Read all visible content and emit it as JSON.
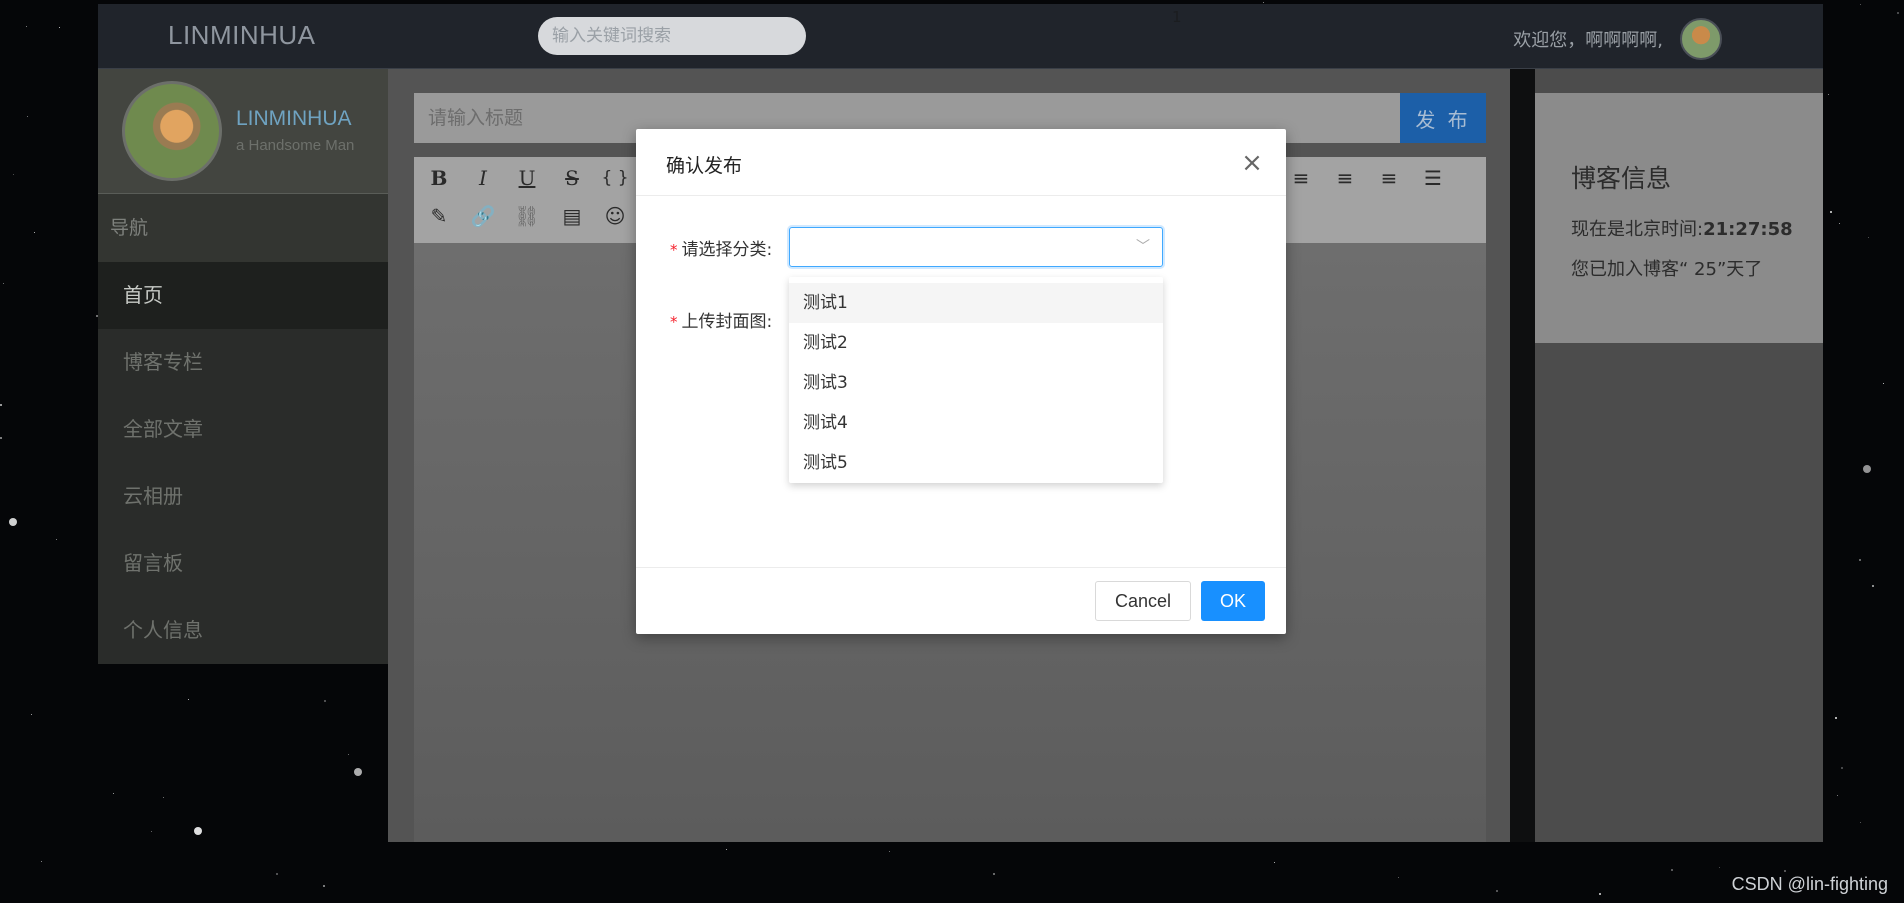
{
  "header": {
    "brand": "LINMINHUA",
    "search_placeholder": "输入关键词搜索",
    "marker": "1",
    "welcome": "欢迎您，啊啊啊啊,"
  },
  "sidebar": {
    "name": "LINMINHUA",
    "tagline": "a Handsome Man",
    "nav_heading": "导航",
    "items": [
      {
        "label": "首页",
        "active": true
      },
      {
        "label": "博客专栏"
      },
      {
        "label": "全部文章"
      },
      {
        "label": "云相册"
      },
      {
        "label": "留言板"
      },
      {
        "label": "个人信息"
      }
    ]
  },
  "editor": {
    "title_placeholder": "请输入标题",
    "publish_label": "发 布",
    "toolbar_row1": [
      "B",
      "I",
      "U",
      "S",
      "{ }"
    ],
    "toolbar_icons_row1": [
      "bold-icon",
      "italic-icon",
      "underline-icon",
      "strikethrough-icon",
      "code-icon"
    ],
    "toolbar_icons_row2": [
      "pen-icon",
      "link-icon",
      "unlink-icon",
      "code-block-icon",
      "emoji-icon"
    ],
    "toolbar_icons_right": [
      "align-left-icon",
      "align-center-icon",
      "align-right-icon",
      "align-justify-icon"
    ]
  },
  "blog_info": {
    "title": "博客信息",
    "time_label": "现在是北京时间:",
    "time_value": "21:27:58",
    "joined": "您已加入博客“ 25”天了"
  },
  "modal": {
    "title": "确认发布",
    "category_label": "请选择分类:",
    "cover_label": "上传封面图:",
    "options": [
      "测试1",
      "测试2",
      "测试3",
      "测试4",
      "测试5"
    ],
    "cancel_label": "Cancel",
    "ok_label": "OK"
  },
  "watermark": "CSDN @lin-fighting",
  "colors": {
    "primary": "#1890ff",
    "publish": "#1c5fa8",
    "header_bg": "#20242b"
  }
}
